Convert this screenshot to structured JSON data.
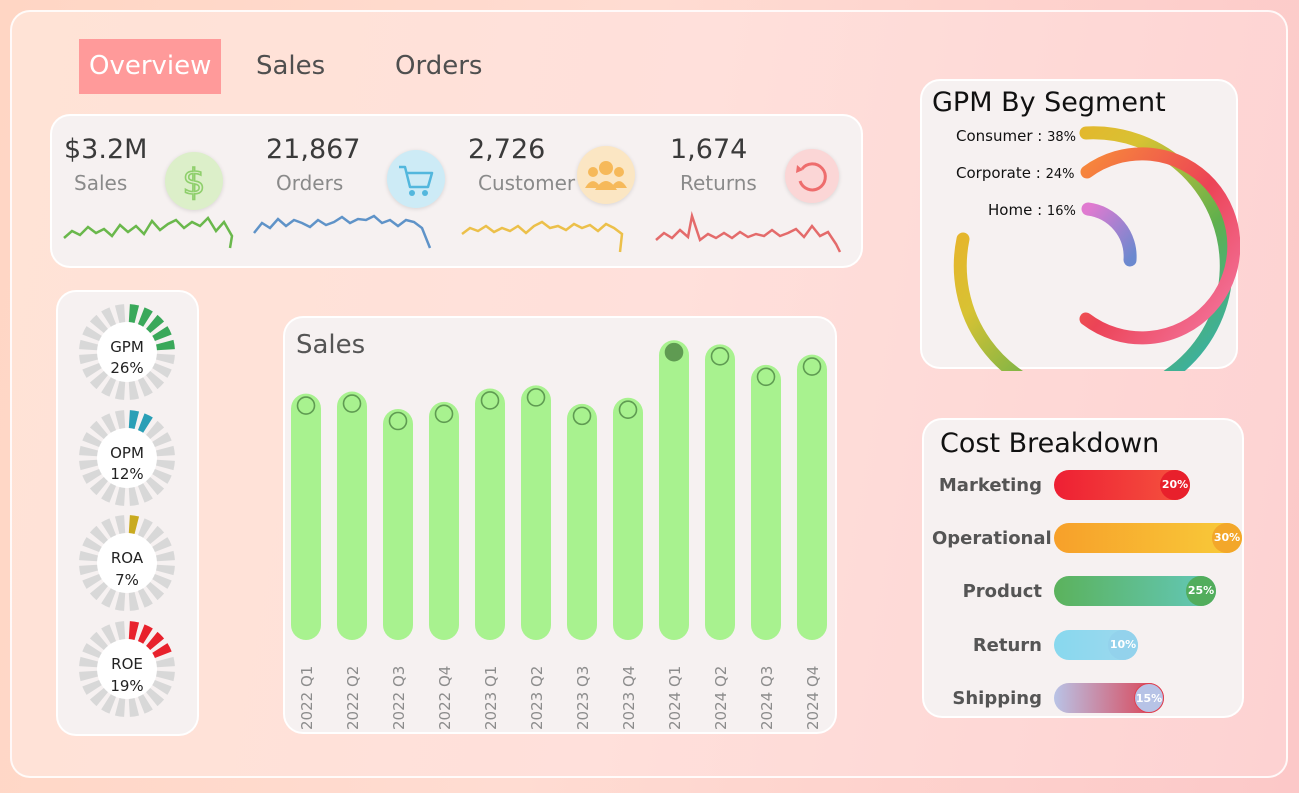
{
  "tabs": [
    {
      "label": "Overview",
      "active": true
    },
    {
      "label": "Sales",
      "active": false
    },
    {
      "label": "Orders",
      "active": false
    }
  ],
  "kpis": [
    {
      "value": "$3.2M",
      "label": "Sales",
      "icon": "dollar-icon",
      "color": "#6ab84c",
      "iconbg": "#dcefc9"
    },
    {
      "value": "21,867",
      "label": "Orders",
      "icon": "cart-icon",
      "color": "#5f93c8",
      "iconbg": "#cdebf6"
    },
    {
      "value": "2,726",
      "label": "Customer",
      "icon": "people-icon",
      "color": "#ecc04a",
      "iconbg": "#fbe6c3"
    },
    {
      "value": "1,674",
      "label": "Returns",
      "icon": "return-icon",
      "color": "#e46b6b",
      "iconbg": "#fbd6d6"
    }
  ],
  "ratios": [
    {
      "label": "GPM",
      "value": "26%",
      "pct": 26,
      "color": "#3aa85a"
    },
    {
      "label": "OPM",
      "value": "12%",
      "pct": 12,
      "color": "#2a9fb6"
    },
    {
      "label": "ROA",
      "value": "7%",
      "pct": 7,
      "color": "#c9aa1f"
    },
    {
      "label": "ROE",
      "value": "19%",
      "pct": 19,
      "color": "#e8212c"
    }
  ],
  "sales_chart": {
    "title": "Sales",
    "chart_data": {
      "type": "bar",
      "categories": [
        "2022 Q1",
        "2022 Q2",
        "2022 Q3",
        "2022 Q4",
        "2023 Q1",
        "2023 Q2",
        "2023 Q3",
        "2023 Q4",
        "2024 Q1",
        "2024 Q2",
        "2024 Q3",
        "2024 Q4"
      ],
      "values": [
        240,
        242,
        225,
        232,
        245,
        248,
        230,
        236,
        292,
        288,
        268,
        278
      ],
      "ylim": [
        0,
        300
      ],
      "highlight_index": 8
    }
  },
  "gpm_segment": {
    "title": "GPM By Segment",
    "chart_data": {
      "type": "radial-bar",
      "series": [
        {
          "name": "Consumer",
          "value": 38,
          "label": "38%"
        },
        {
          "name": "Corporate",
          "value": 24,
          "label": "24%"
        },
        {
          "name": "Home",
          "value": 16,
          "label": "16%"
        }
      ]
    },
    "separator": ":"
  },
  "cost_breakdown": {
    "title": "Cost Breakdown",
    "chart_data": {
      "type": "bar",
      "categories": [
        "Marketing",
        "Operational",
        "Product",
        "Return",
        "Shipping"
      ],
      "values": [
        20,
        30,
        25,
        10,
        15
      ],
      "labels": [
        "20%",
        "30%",
        "25%",
        "10%",
        "15%"
      ]
    }
  }
}
